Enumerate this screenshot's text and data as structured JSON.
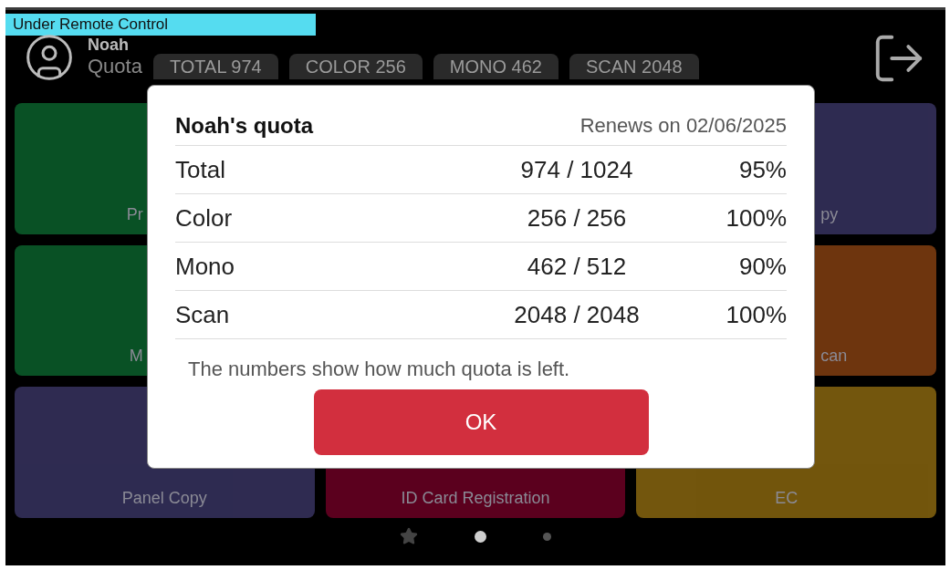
{
  "banner": {
    "text": "Under Remote Control"
  },
  "header": {
    "user_name": "Noah",
    "quota_label": "Quota",
    "chips": [
      {
        "text": "TOTAL 974"
      },
      {
        "text": "COLOR 256"
      },
      {
        "text": "MONO 462"
      },
      {
        "text": "SCAN 2048"
      }
    ]
  },
  "tile_rows": [
    {
      "tiles": [
        {
          "label": "Pr",
          "kind": "clipped-start",
          "color": "#0b5a2a"
        },
        {
          "label": "py",
          "kind": "clipped-end",
          "color": "#34305a"
        }
      ]
    },
    {
      "tiles": [
        {
          "label": "M",
          "kind": "clipped-start",
          "color": "#0b5a2a"
        },
        {
          "label": "can",
          "kind": "clipped-end",
          "color": "#7a3b10"
        }
      ]
    },
    {
      "tiles": [
        {
          "label": "Panel Copy",
          "kind": "full",
          "color": "#34305a"
        },
        {
          "label": "ID Card Registration",
          "kind": "full",
          "color": "#650022"
        },
        {
          "label": "EC",
          "kind": "full",
          "color": "#7f5f0e"
        }
      ]
    }
  ],
  "pager": [
    {
      "kind": "star",
      "selected": false
    },
    {
      "kind": "dot",
      "selected": true
    },
    {
      "kind": "dot",
      "selected": false
    }
  ],
  "dialog": {
    "title": "Noah's quota",
    "renews": "Renews on 02/06/2025",
    "rows": [
      {
        "name": "Total",
        "amount": "974 / 1024",
        "percent": "95%"
      },
      {
        "name": "Color",
        "amount": "256 / 256",
        "percent": "100%"
      },
      {
        "name": "Mono",
        "amount": "462 / 512",
        "percent": "90%"
      },
      {
        "name": "Scan",
        "amount": "2048 / 2048",
        "percent": "100%"
      }
    ],
    "note": "The numbers show how much quota is left.",
    "ok": "OK"
  }
}
